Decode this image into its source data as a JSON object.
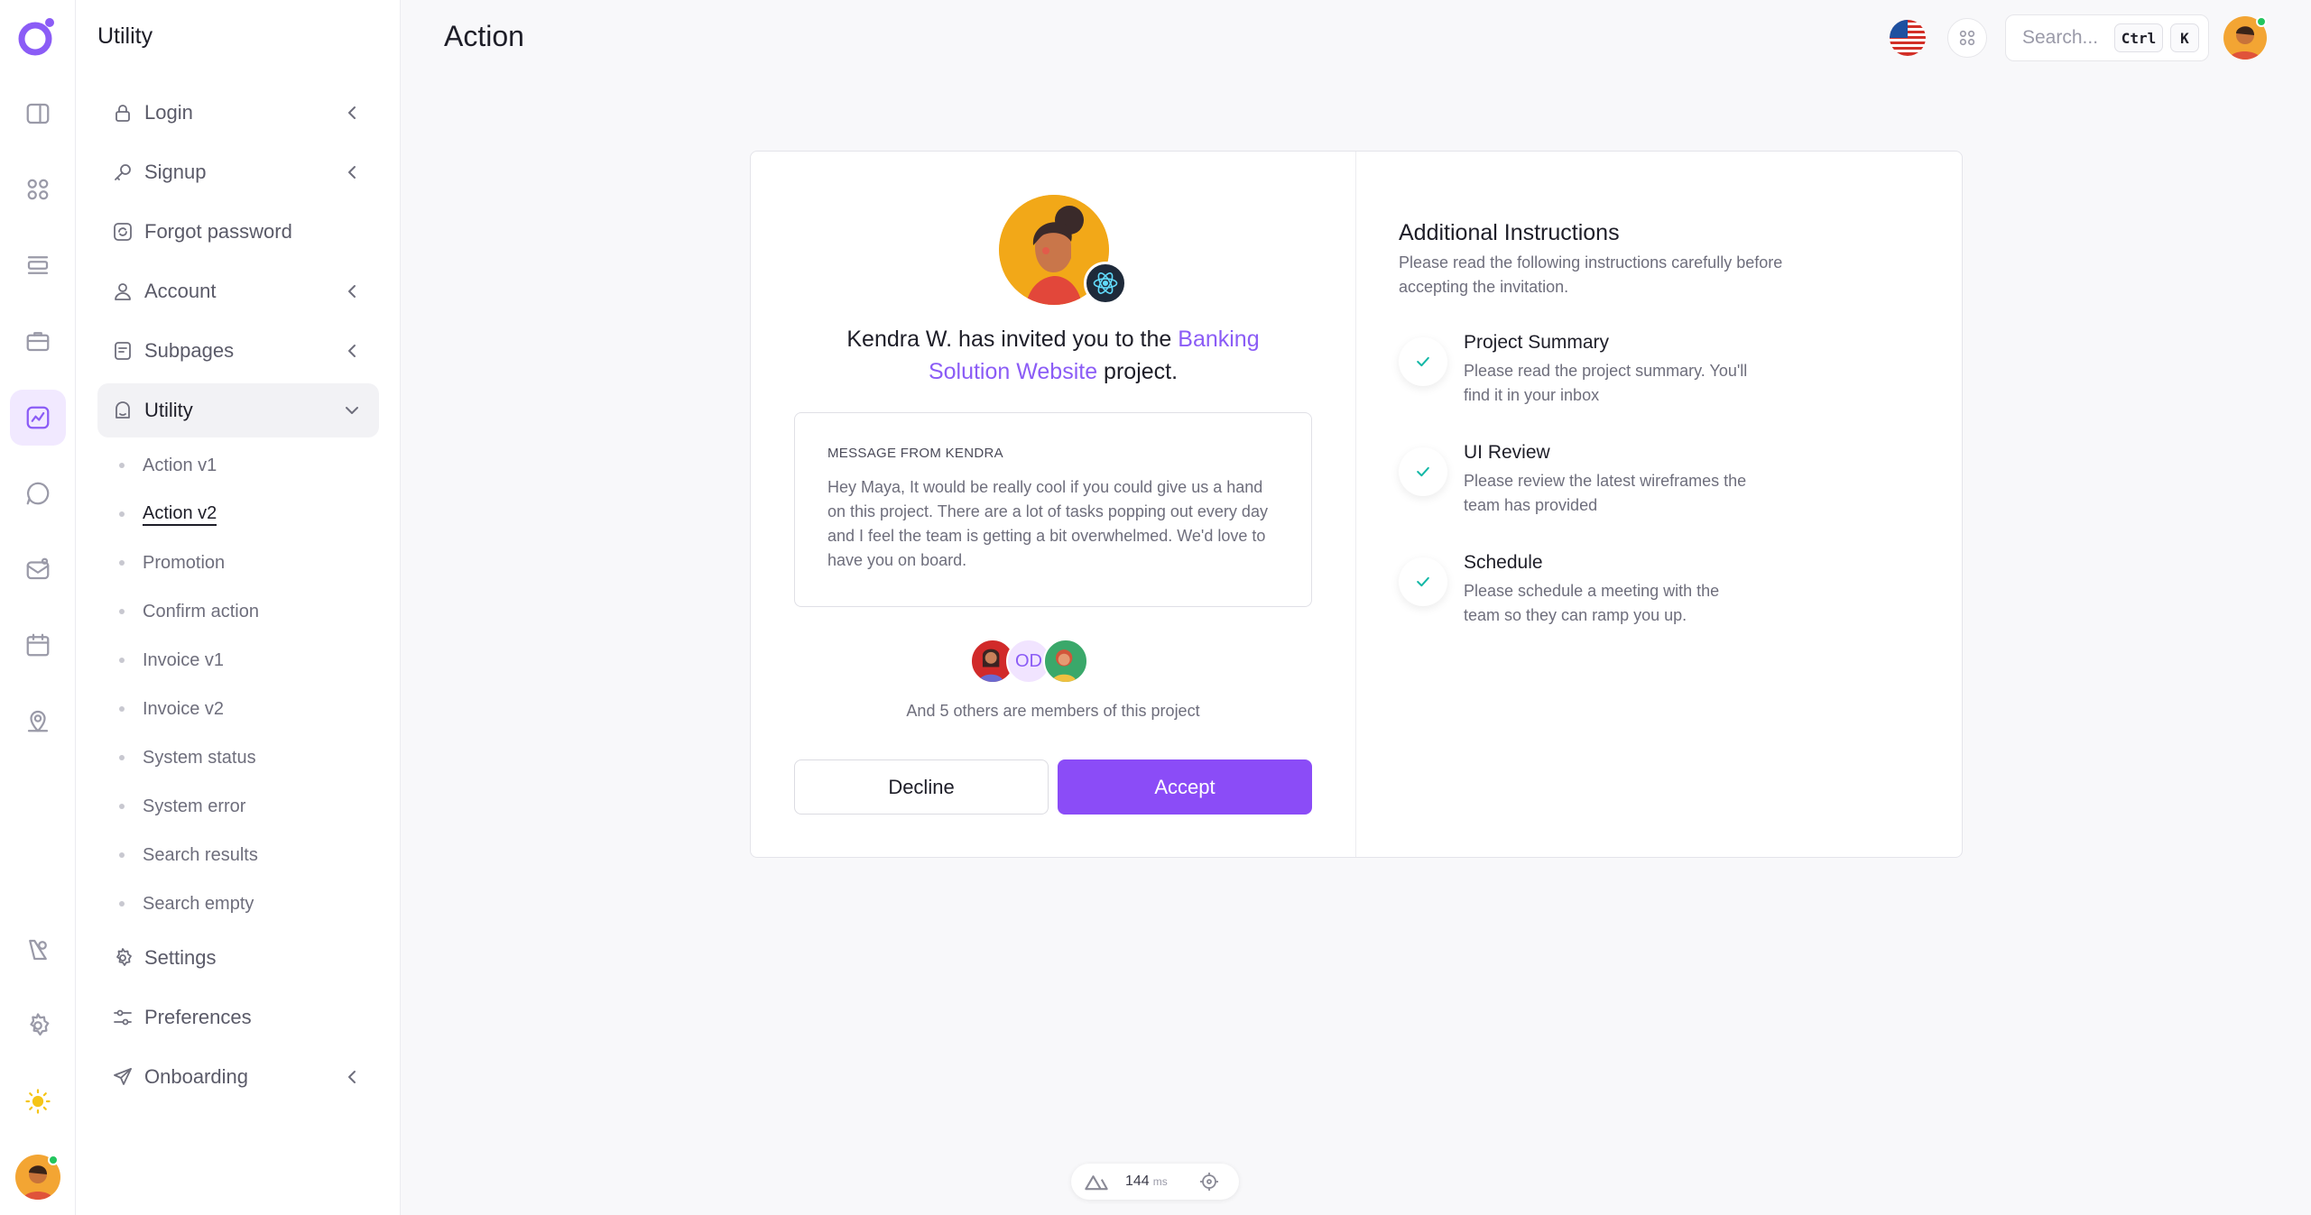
{
  "sidebar": {
    "title": "Utility",
    "items": [
      {
        "label": "Login"
      },
      {
        "label": "Signup"
      },
      {
        "label": "Forgot password"
      },
      {
        "label": "Account"
      },
      {
        "label": "Subpages"
      },
      {
        "label": "Utility"
      },
      {
        "label": "Settings"
      },
      {
        "label": "Preferences"
      },
      {
        "label": "Onboarding"
      }
    ],
    "sub_items": [
      {
        "label": "Action v1"
      },
      {
        "label": "Action v2"
      },
      {
        "label": "Promotion"
      },
      {
        "label": "Confirm action"
      },
      {
        "label": "Invoice v1"
      },
      {
        "label": "Invoice v2"
      },
      {
        "label": "System status"
      },
      {
        "label": "System error"
      },
      {
        "label": "Search results"
      },
      {
        "label": "Search empty"
      }
    ]
  },
  "header": {
    "title": "Action",
    "search_placeholder": "Search...",
    "kbd_ctrl": "Ctrl",
    "kbd_k": "K"
  },
  "invite": {
    "text_before": "Kendra W. has invited you to the ",
    "project_name": "Banking Solution Website",
    "text_after": " project.",
    "message_label": "MESSAGE FROM KENDRA",
    "message_body": "Hey Maya, It would be really cool if you could give us a hand on this project. There are a lot of tasks popping out every day and I feel the team is getting a bit overwhelmed. We'd love to have you on board.",
    "member_initials": "OD",
    "members_text": "And 5 others are members of this project",
    "decline_label": "Decline",
    "accept_label": "Accept"
  },
  "instructions": {
    "title": "Additional Instructions",
    "subtitle": "Please read the following instructions carefully before accepting the invitation.",
    "steps": [
      {
        "title": "Project Summary",
        "desc": "Please read the project summary. You'll find it in your inbox"
      },
      {
        "title": "UI Review",
        "desc": "Please review the latest wireframes the team has provided"
      },
      {
        "title": "Schedule",
        "desc": "Please schedule a meeting with the team so they can ramp you up."
      }
    ]
  },
  "perf": {
    "value": "144",
    "unit": "ms"
  },
  "colors": {
    "accent": "#8b5cf6",
    "check": "#14b8a6"
  }
}
